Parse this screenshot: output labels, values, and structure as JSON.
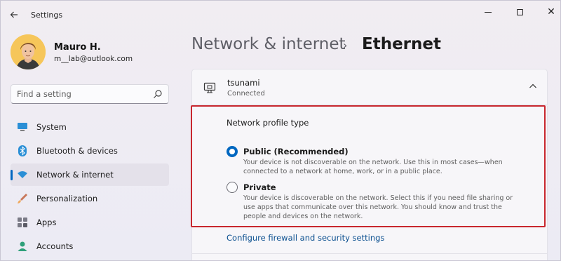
{
  "window": {
    "app_title": "Settings"
  },
  "profile": {
    "name": "Mauro H.",
    "email": "m__lab@outlook.com"
  },
  "search": {
    "placeholder": "Find a setting",
    "icon": "search-icon"
  },
  "sidebar": {
    "items": [
      {
        "label": "System",
        "icon": "monitor-icon",
        "selected": false
      },
      {
        "label": "Bluetooth & devices",
        "icon": "bluetooth-icon",
        "selected": false
      },
      {
        "label": "Network & internet",
        "icon": "wifi-icon",
        "selected": true
      },
      {
        "label": "Personalization",
        "icon": "brush-icon",
        "selected": false
      },
      {
        "label": "Apps",
        "icon": "apps-icon",
        "selected": false
      },
      {
        "label": "Accounts",
        "icon": "person-icon",
        "selected": false
      }
    ]
  },
  "breadcrumb": {
    "parent": "Network & internet",
    "separator": "›",
    "current": "Ethernet"
  },
  "adapter": {
    "name": "tsunami",
    "status": "Connected"
  },
  "profile_type": {
    "title": "Network profile type",
    "options": [
      {
        "label": "Public (Recommended)",
        "description": "Your device is not discoverable on the network. Use this in most cases—when connected to a network at home, work, or in a public place.",
        "checked": true
      },
      {
        "label": "Private",
        "description": "Your device is discoverable on the network. Select this if you need file sharing or use apps that communicate over this network. You should know and trust the people and devices on the network.",
        "checked": false
      }
    ]
  },
  "firewall_link": "Configure firewall and security settings",
  "colors": {
    "accent": "#0067c0",
    "highlight_border": "#c8272e"
  }
}
